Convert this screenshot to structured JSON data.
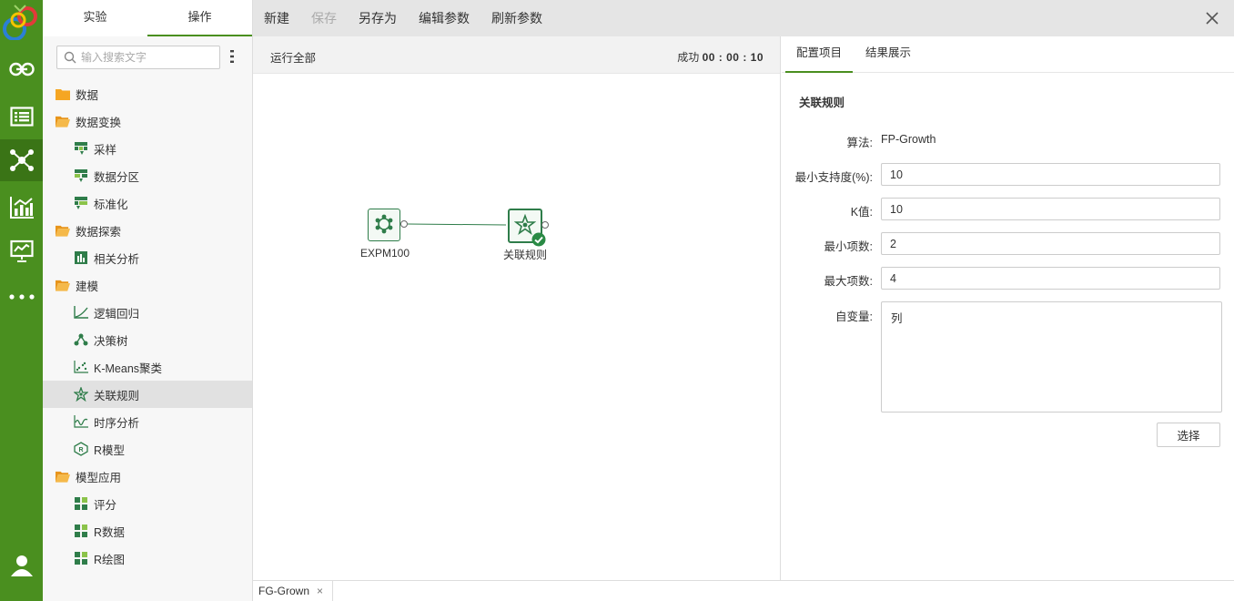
{
  "colors": {
    "brand_green": "#4a8f1f",
    "node_green": "#2f7d4a",
    "folder_orange": "#f5a623",
    "success_green": "#2a8a45"
  },
  "rail": {
    "logo_icon": "app-logo-icon",
    "items": [
      {
        "name": "link-icon"
      },
      {
        "name": "list-icon"
      },
      {
        "name": "network-icon",
        "active": true
      },
      {
        "name": "chart-icon"
      },
      {
        "name": "presentation-icon"
      },
      {
        "name": "more-icon"
      },
      {
        "name": "user-icon"
      }
    ]
  },
  "tree": {
    "tabs": [
      {
        "label": "实验"
      },
      {
        "label": "操作",
        "active": true
      }
    ],
    "search_placeholder": "输入搜索文字",
    "items": [
      {
        "type": "folder",
        "label": "数据",
        "icon": "folder-icon"
      },
      {
        "type": "folder",
        "label": "数据变换",
        "icon": "folder-open-icon"
      },
      {
        "type": "leaf",
        "label": "采样",
        "icon": "sample-icon"
      },
      {
        "type": "leaf",
        "label": "数据分区",
        "icon": "partition-icon"
      },
      {
        "type": "leaf",
        "label": "标准化",
        "icon": "normalize-icon"
      },
      {
        "type": "folder",
        "label": "数据探索",
        "icon": "folder-open-icon"
      },
      {
        "type": "leaf",
        "label": "相关分析",
        "icon": "correlation-icon"
      },
      {
        "type": "folder",
        "label": "建模",
        "icon": "folder-open-icon"
      },
      {
        "type": "leaf",
        "label": "逻辑回归",
        "icon": "regression-icon"
      },
      {
        "type": "leaf",
        "label": "决策树",
        "icon": "tree-icon"
      },
      {
        "type": "leaf",
        "label": "K-Means聚类",
        "icon": "cluster-icon"
      },
      {
        "type": "leaf",
        "label": "关联规则",
        "icon": "association-icon",
        "selected": true
      },
      {
        "type": "leaf",
        "label": "时序分析",
        "icon": "timeseries-icon"
      },
      {
        "type": "leaf",
        "label": "R模型",
        "icon": "r-model-icon"
      },
      {
        "type": "folder",
        "label": "模型应用",
        "icon": "folder-open-icon"
      },
      {
        "type": "leaf",
        "label": "评分",
        "icon": "score-icon"
      },
      {
        "type": "leaf",
        "label": "R数据",
        "icon": "r-data-icon"
      },
      {
        "type": "leaf",
        "label": "R绘图",
        "icon": "r-plot-icon"
      }
    ]
  },
  "toolbar": {
    "new": "新建",
    "save": "保存",
    "save_as": "另存为",
    "edit_params": "编辑参数",
    "refresh_params": "刷新参数"
  },
  "canvas": {
    "run_all": "运行全部",
    "status_label": "成功",
    "status_time": "00 : 00 : 10",
    "nodes": [
      {
        "label": "EXPM100",
        "icon": "dataset-icon"
      },
      {
        "label": "关联规则",
        "icon": "association-icon",
        "status": "success"
      }
    ]
  },
  "bottom_tab": {
    "label": "FG-Grown"
  },
  "panel": {
    "tabs": [
      {
        "label": "配置项目",
        "active": true
      },
      {
        "label": "结果展示"
      }
    ],
    "section_title": "关联规则",
    "algorithm_label": "算法:",
    "algorithm_value": "FP-Growth",
    "min_support_label": "最小支持度(%):",
    "min_support_value": "10",
    "k_label": "K值:",
    "k_value": "10",
    "min_items_label": "最小项数:",
    "min_items_value": "2",
    "max_items_label": "最大项数:",
    "max_items_value": "4",
    "vars_label": "自变量:",
    "vars_value": "列",
    "select_button": "选择"
  }
}
